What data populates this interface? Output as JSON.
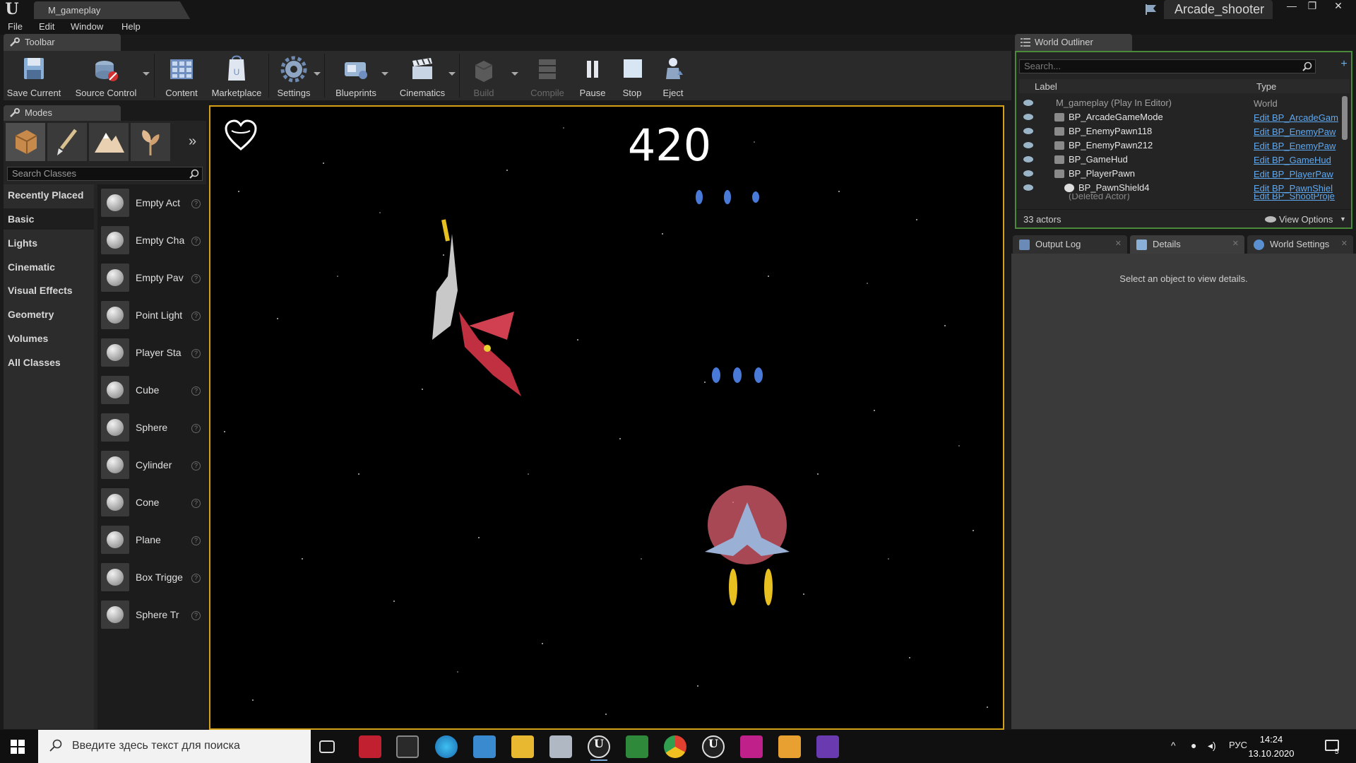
{
  "window": {
    "doc_tab": "M_gameplay",
    "project": "Arcade_shooter",
    "controls": [
      "—",
      "❐",
      "✕"
    ]
  },
  "menu": [
    "File",
    "Edit",
    "Window",
    "Help"
  ],
  "toolbar": {
    "tab_label": "Toolbar",
    "buttons": {
      "save_current": "Save Current",
      "source_control": "Source Control",
      "content": "Content",
      "marketplace": "Marketplace",
      "settings": "Settings",
      "blueprints": "Blueprints",
      "cinematics": "Cinematics",
      "build": "Build",
      "compile": "Compile",
      "pause": "Pause",
      "stop": "Stop",
      "eject": "Eject"
    }
  },
  "modes": {
    "tab_label": "Modes",
    "search_placeholder": "Search Classes",
    "categories": [
      "Recently Placed",
      "Basic",
      "Lights",
      "Cinematic",
      "Visual Effects",
      "Geometry",
      "Volumes",
      "All Classes"
    ],
    "active_category": "Basic",
    "classes": [
      "Empty Act",
      "Empty Cha",
      "Empty Pav",
      "Point Light",
      "Player Sta",
      "Cube",
      "Sphere",
      "Cylinder",
      "Cone",
      "Plane",
      "Box Trigge",
      "Sphere Tr"
    ]
  },
  "viewport": {
    "score": "420"
  },
  "world_outliner": {
    "tab_label": "World Outliner",
    "search_placeholder": "Search...",
    "col_label": "Label",
    "col_type": "Type",
    "rows": [
      {
        "label": "M_gameplay (Play In Editor)",
        "type": "World"
      },
      {
        "label": "BP_ArcadeGameMode",
        "type": "Edit BP_ArcadeGam"
      },
      {
        "label": "BP_EnemyPawn118",
        "type": "Edit BP_EnemyPaw"
      },
      {
        "label": "BP_EnemyPawn212",
        "type": "Edit BP_EnemyPaw"
      },
      {
        "label": "BP_GameHud",
        "type": "Edit BP_GameHud"
      },
      {
        "label": "BP_PlayerPawn",
        "type": "Edit BP_PlayerPaw"
      },
      {
        "label": "BP_PawnShield4",
        "type": "Edit BP_PawnShiel"
      },
      {
        "label": "(Deleted Actor)",
        "type": "Edit BP_ShootProje"
      }
    ],
    "actor_count": "33 actors",
    "view_options": "View Options"
  },
  "details_tabs": {
    "output_log": "Output Log",
    "details": "Details",
    "world_settings": "World Settings"
  },
  "details_message": "Select an object to view details.",
  "taskbar": {
    "search_placeholder": "Введите здесь текст для поиска",
    "lang": "РУС",
    "time": "14:24",
    "date": "13.10.2020",
    "notification_count": "5"
  }
}
